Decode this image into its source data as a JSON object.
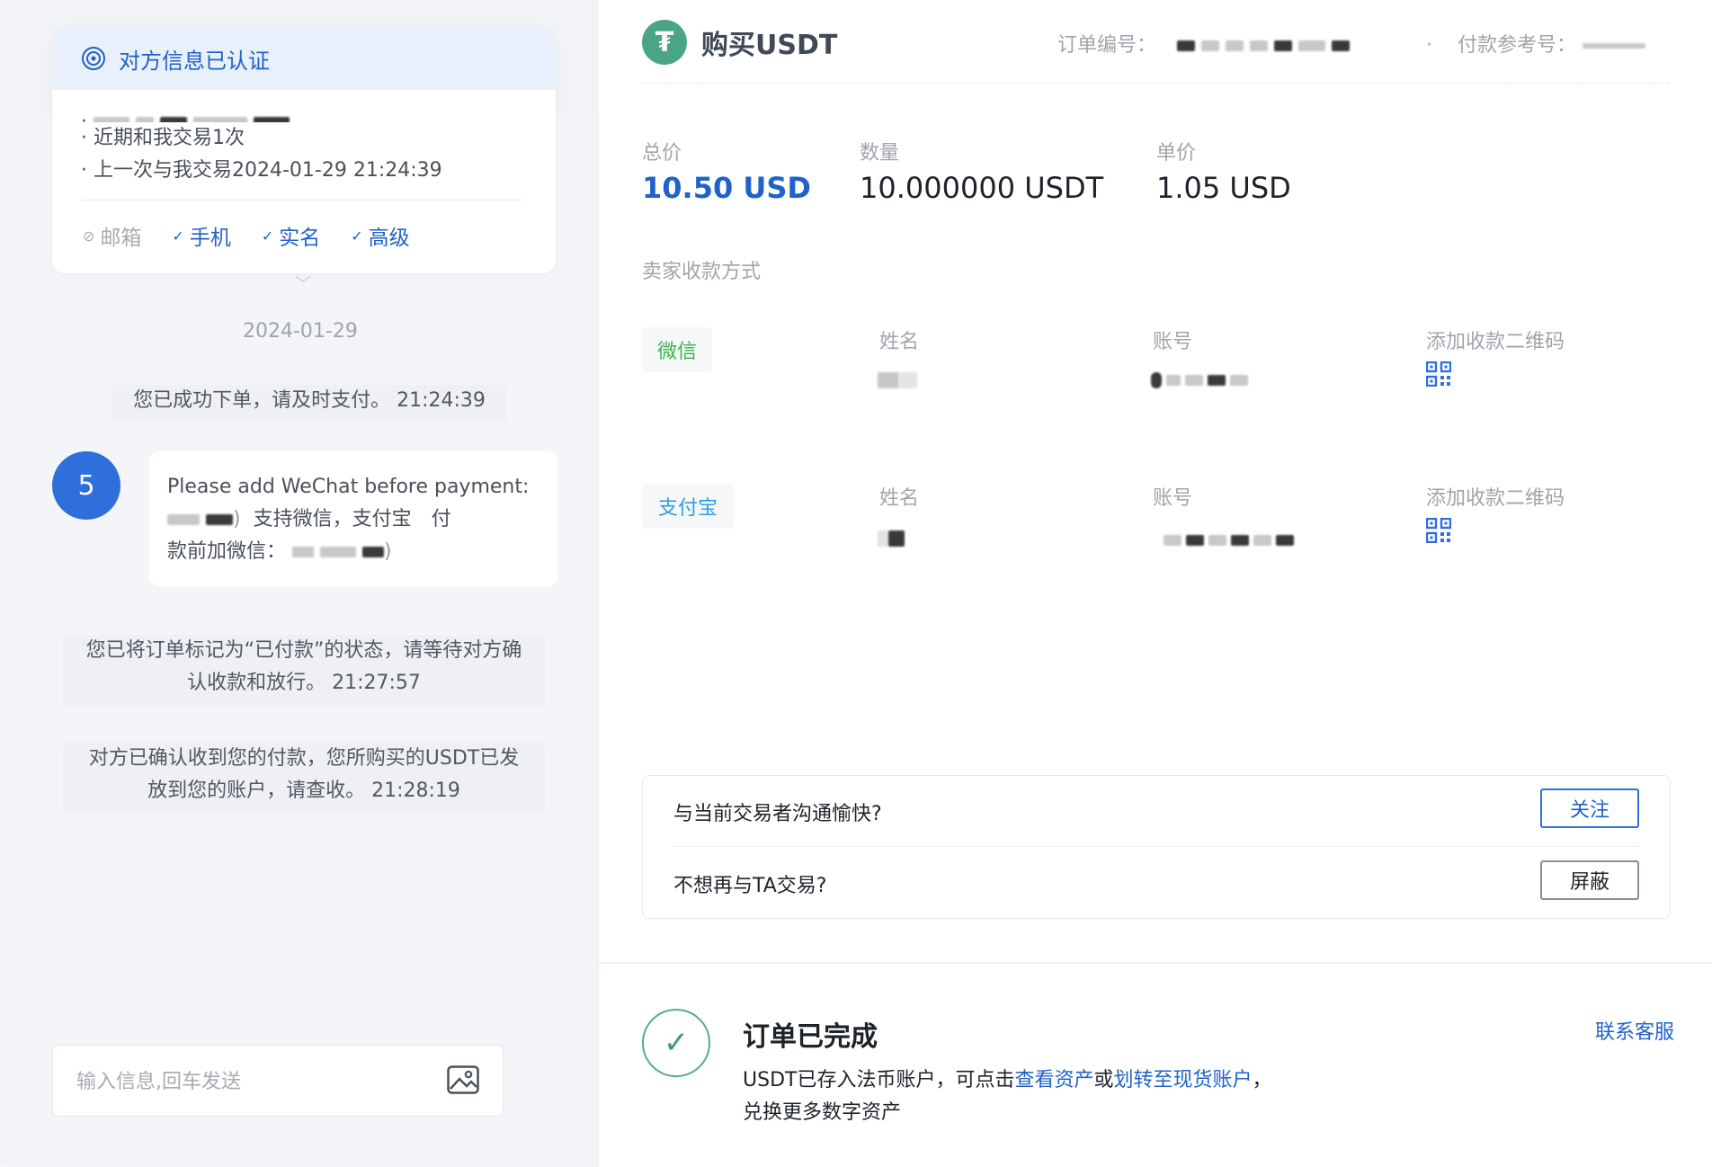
{
  "left": {
    "verify_card": {
      "title": "对方信息已认证",
      "lines": [
        "近期和我交易1次",
        "上一次与我交易2024-01-29 21:24:39"
      ],
      "tags": [
        {
          "label": "邮箱",
          "verified": false
        },
        {
          "label": "手机",
          "verified": true
        },
        {
          "label": "实名",
          "verified": true
        },
        {
          "label": "高级",
          "verified": true
        }
      ]
    },
    "chat": {
      "date": "2024-01-29",
      "msg_order_placed": "您已成功下单，请及时支付。 21:24:39",
      "avatar_count": "5",
      "bubble_line1": "Please add WeChat before payment:",
      "bubble_line2_mid": "支持微信，支付宝　付",
      "bubble_line3_prefix": "款前加微信：",
      "msg_marked_paid_1": "您已将订单标记为“已付款”的状态，请等待对方确",
      "msg_marked_paid_2": "认收款和放行。 21:27:57",
      "msg_released_1": "对方已确认收到您的付款，您所购买的USDT已发",
      "msg_released_2": "放到您的账户，请查收。 21:28:19"
    },
    "input": {
      "placeholder": "输入信息,回车发送"
    }
  },
  "order": {
    "logo_char": "₮",
    "title": "购买USDT",
    "order_no_label": "订单编号：",
    "ref_label": "付款参考号：",
    "total_label": "总价",
    "total_value": "10.50 USD",
    "qty_label": "数量",
    "qty_value": "10.000000 USDT",
    "price_label": "单价",
    "price_value": "1.05 USD",
    "methods_label": "卖家收款方式",
    "methods": [
      {
        "name": "微信",
        "color": "#3cb44b",
        "name_label": "姓名",
        "account_label": "账号",
        "qr_label": "添加收款二维码"
      },
      {
        "name": "支付宝",
        "color": "#2d9fe0",
        "name_label": "姓名",
        "account_label": "账号",
        "qr_label": "添加收款二维码"
      }
    ],
    "feedback": {
      "q1": "与当前交易者沟通愉快?",
      "follow": "关注",
      "q2": "不想再与TA交易?",
      "block": "屏蔽"
    }
  },
  "completion": {
    "title": "订单已完成",
    "desc_prefix": "USDT已存入法币账户，可点击",
    "link_assets": "查看资产",
    "desc_or": "或",
    "link_transfer": "划转至现货账户",
    "desc_suffix": "，",
    "desc_line2": "兑换更多数字资产",
    "support": "联系客服"
  }
}
